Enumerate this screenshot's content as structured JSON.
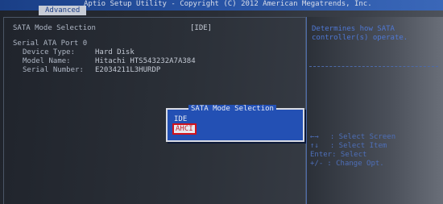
{
  "header": {
    "title": "Aptio Setup Utility - Copyright (C) 2012 American Megatrends, Inc.",
    "active_tab": "Advanced"
  },
  "main": {
    "sata_mode": {
      "label": "SATA Mode Selection",
      "value": "[IDE]"
    },
    "port_heading": "Serial ATA Port 0",
    "fields": [
      {
        "label": "Device Type:",
        "value": "Hard Disk"
      },
      {
        "label": "Model Name:",
        "value": "Hitachi HTS543232A7A384"
      },
      {
        "label": "Serial Number:",
        "value": "E2034211L3HURDP"
      }
    ]
  },
  "help": {
    "description_line1": "Determines how SATA",
    "description_line2": "controller(s) operate.",
    "keys": [
      {
        "key": "←→",
        "action": ": Select Screen"
      },
      {
        "key": "↑↓",
        "action": ": Select Item"
      },
      {
        "key": "Enter",
        "action": ": Select"
      },
      {
        "key": "+/-",
        "action": ": Change Opt."
      }
    ]
  },
  "dialog": {
    "title": "SATA Mode Selection",
    "options": [
      "IDE",
      "AHCI"
    ],
    "selected": "AHCI"
  },
  "colors": {
    "title_bar": "#2854a6",
    "dialog_bg": "#2350b4",
    "selection_border": "#d0121d",
    "selection_text": "#c21f2a"
  }
}
